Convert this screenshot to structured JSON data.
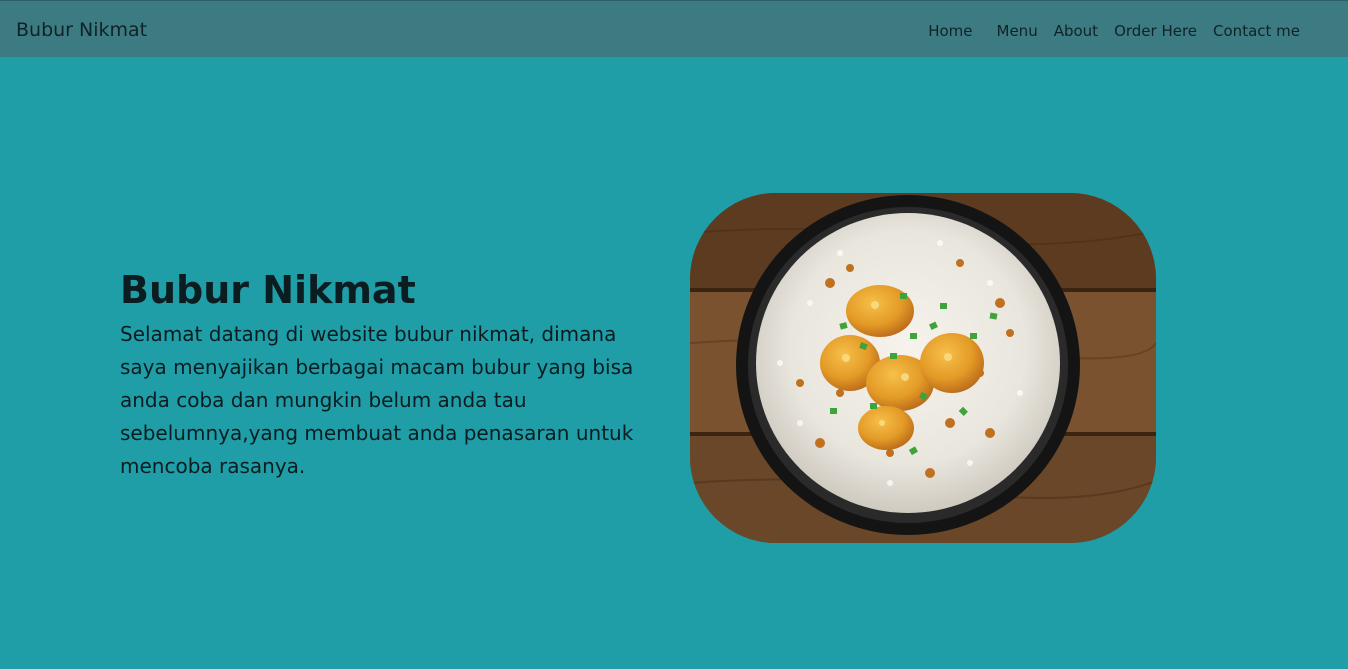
{
  "navbar": {
    "brand": "Bubur Nikmat",
    "links": [
      "Home",
      "Menu",
      "About",
      "Order Here",
      "Contact me"
    ]
  },
  "hero": {
    "title": "Bubur Nikmat",
    "description": "Selamat datang di website bubur nikmat, dimana saya menyajikan berbagai macam bubur yang bisa anda coba dan mungkin belum anda tau sebelumnya,yang membuat anda penasaran untuk mencoba rasanya.",
    "image_subject": "bowl of bubur (rice porridge) with fried dough, fried shallots and scallions on wooden table"
  },
  "colors": {
    "background": "#1f9ea7",
    "navbar": "#3d7b83",
    "text": "#0b1d20"
  }
}
